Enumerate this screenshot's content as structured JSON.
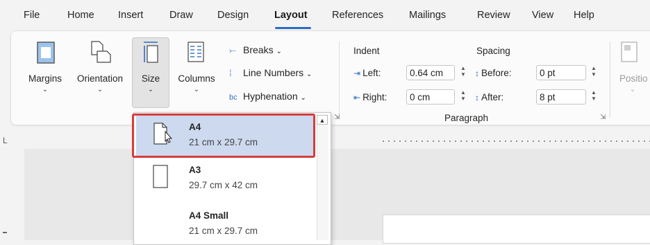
{
  "tabs": [
    "File",
    "Home",
    "Insert",
    "Draw",
    "Design",
    "Layout",
    "References",
    "Mailings",
    "Review",
    "View",
    "Help"
  ],
  "active_tab": "Layout",
  "ribbon": {
    "margins_label": "Margins",
    "orientation_label": "Orientation",
    "size_label": "Size",
    "columns_label": "Columns",
    "breaks_label": "Breaks",
    "line_numbers_label": "Line Numbers",
    "hyphenation_label": "Hyphenation",
    "dropdown_chevron": "⌄",
    "indent": {
      "title": "Indent",
      "left_label": "Left:",
      "left_value": "0.64 cm",
      "right_label": "Right:",
      "right_value": "0 cm"
    },
    "spacing": {
      "title": "Spacing",
      "before_label": "Before:",
      "before_value": "0 pt",
      "after_label": "After:",
      "after_value": "8 pt"
    },
    "paragraph_group": "Paragraph",
    "position_label": "Positio"
  },
  "size_menu": {
    "items": [
      {
        "name": "A4",
        "dimensions": "21 cm x 29.7 cm",
        "selected": true
      },
      {
        "name": "A3",
        "dimensions": "29.7 cm x 42 cm",
        "selected": false
      },
      {
        "name": "A4 Small",
        "dimensions": "21 cm x 29.7 cm",
        "selected": false
      }
    ]
  },
  "ruler": {
    "left_marker": "L"
  },
  "colors": {
    "accent": "#2b6cc4",
    "highlight": "#d83b3b",
    "selected_bg": "#cdd9ee"
  },
  "icons": [
    "margins-icon",
    "orientation-icon",
    "size-icon",
    "columns-icon",
    "breaks-icon",
    "line-numbers-icon",
    "hyphenation-icon",
    "indent-left-icon",
    "indent-right-icon",
    "spacing-before-icon",
    "spacing-after-icon",
    "page-a4-icon",
    "page-a3-icon",
    "cursor-icon"
  ]
}
